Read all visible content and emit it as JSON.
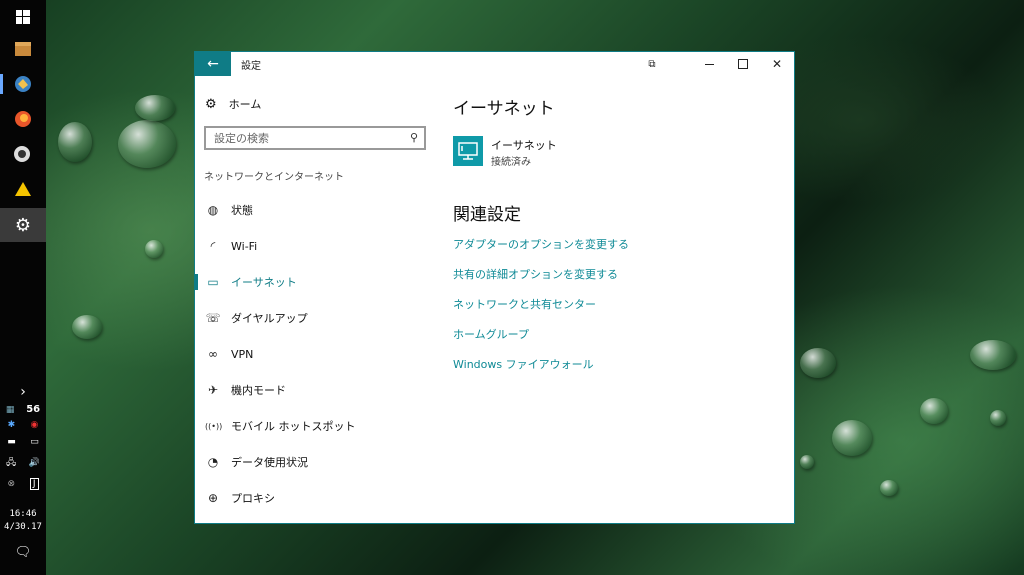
{
  "window": {
    "title": "設定",
    "back_icon": "←",
    "controls": {
      "snap_icon": "⧉",
      "minimize": "—",
      "maximize": "☐",
      "close": "✕"
    }
  },
  "sidebar": {
    "home_label": "ホーム",
    "search_placeholder": "設定の検索",
    "section_title": "ネットワークとインターネット",
    "items": [
      {
        "label": "状態",
        "icon": "◍"
      },
      {
        "label": "Wi-Fi",
        "icon": "◜"
      },
      {
        "label": "イーサネット",
        "icon": "▭",
        "selected": true
      },
      {
        "label": "ダイヤルアップ",
        "icon": "☏"
      },
      {
        "label": "VPN",
        "icon": "∞"
      },
      {
        "label": "機内モード",
        "icon": "✈"
      },
      {
        "label": "モバイル ホットスポット",
        "icon": "((•))"
      },
      {
        "label": "データ使用状況",
        "icon": "◔"
      },
      {
        "label": "プロキシ",
        "icon": "⊕"
      }
    ]
  },
  "main": {
    "heading": "イーサネット",
    "connection": {
      "name": "イーサネット",
      "status": "接続済み"
    },
    "related_heading": "関連設定",
    "links": [
      "アダプターのオプションを変更する",
      "共有の詳細オプションを変更する",
      "ネットワークと共有センター",
      "ホームグループ",
      "Windows ファイアウォール"
    ]
  },
  "taskbar": {
    "tray_chevron": "›",
    "tray_number": "56",
    "time": "16:46",
    "date": "4/30.17",
    "accent_color": "#0f7c86"
  }
}
